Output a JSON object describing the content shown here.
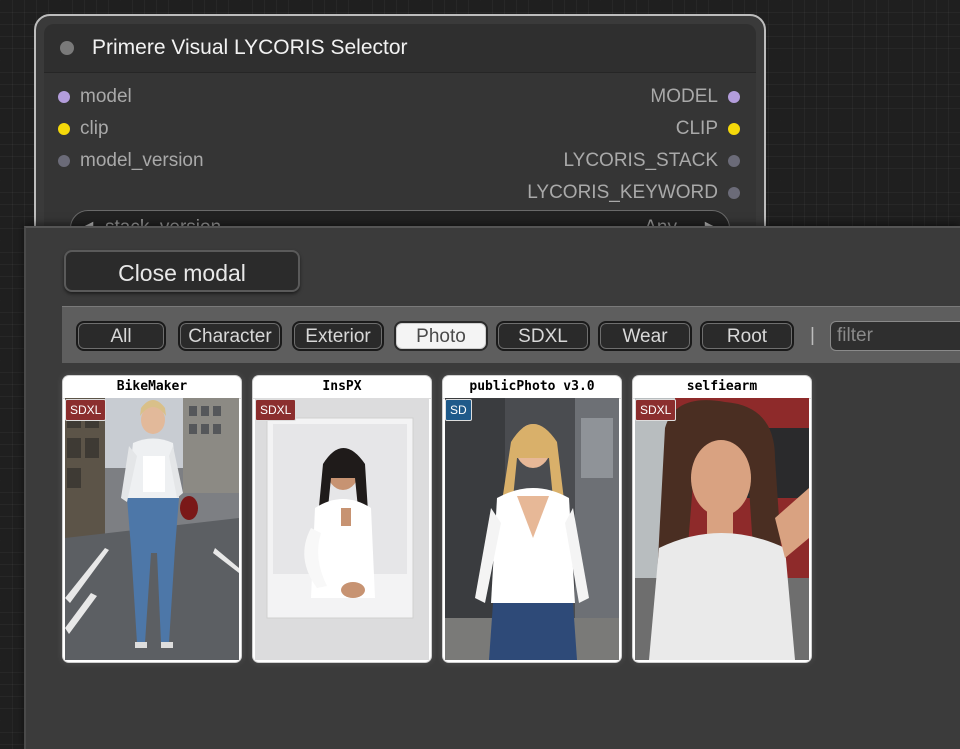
{
  "node": {
    "title": "Primere Visual LYCORIS Selector",
    "inputs": [
      {
        "label": "model",
        "color": "#b39ddb"
      },
      {
        "label": "clip",
        "color": "#f5d90a"
      },
      {
        "label": "model_version",
        "color": "#6b6b78"
      }
    ],
    "outputs": [
      {
        "label": "MODEL",
        "color": "#b39ddb"
      },
      {
        "label": "CLIP",
        "color": "#f5d90a"
      },
      {
        "label": "LYCORIS_STACK",
        "color": "#6b6b78"
      },
      {
        "label": "LYCORIS_KEYWORD",
        "color": "#6b6b78"
      }
    ],
    "widget": {
      "label": "stack_version",
      "value": "Any"
    }
  },
  "modal": {
    "close_label": "Close modal",
    "filter_buttons": [
      {
        "label": "All",
        "active": false
      },
      {
        "label": "Character",
        "active": false
      },
      {
        "label": "Exterior",
        "active": false
      },
      {
        "label": "Photo",
        "active": true
      },
      {
        "label": "SDXL",
        "active": false
      },
      {
        "label": "Wear",
        "active": false
      },
      {
        "label": "Root",
        "active": false
      }
    ],
    "separator": "|",
    "filter_placeholder": "filter",
    "cards": [
      {
        "title": "BikeMaker",
        "badge": "SDXL",
        "badge_color": "#8b2e2e",
        "image": "woman-street-photo"
      },
      {
        "title": "InsPX",
        "badge": "SDXL",
        "badge_color": "#8b2e2e",
        "image": "polaroid-photo"
      },
      {
        "title": "publicPhoto v3.0",
        "badge": "SD",
        "badge_color": "#1f5a8a",
        "image": "woman-white-shirt-photo"
      },
      {
        "title": "selfiearm",
        "badge": "SDXL",
        "badge_color": "#8b2e2e",
        "image": "selfie-photo"
      }
    ]
  }
}
